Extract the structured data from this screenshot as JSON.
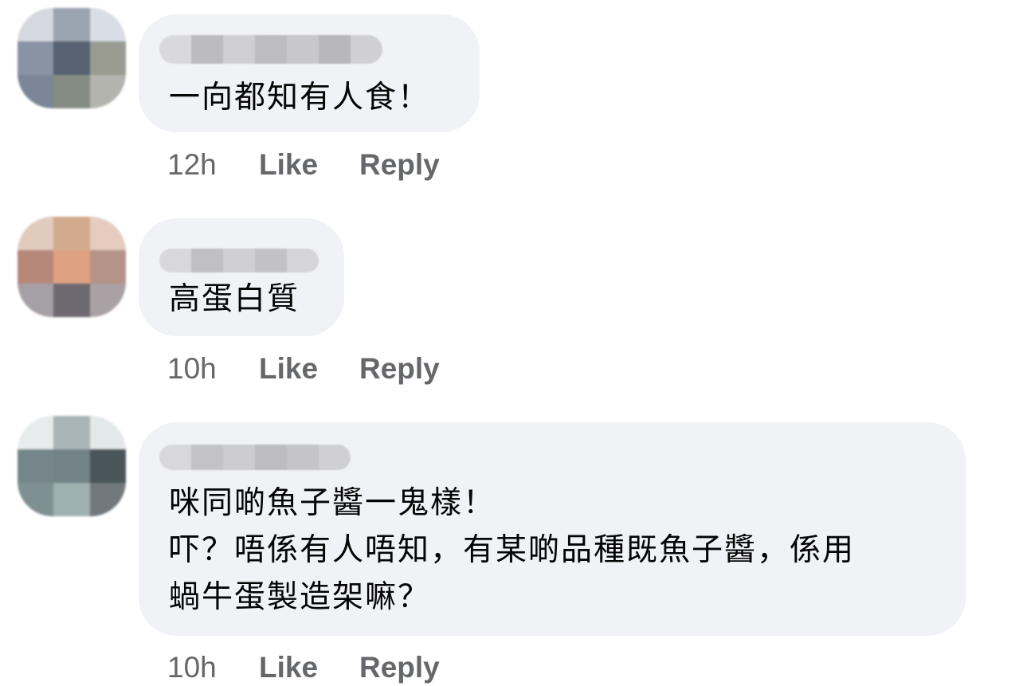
{
  "comments": [
    {
      "text": "一向都知有人食！",
      "time": "12h",
      "like_label": "Like",
      "reply_label": "Reply"
    },
    {
      "text": "高蛋白質",
      "time": "10h",
      "like_label": "Like",
      "reply_label": "Reply"
    },
    {
      "text": "咪同啲魚子醬一鬼樣！\n吓？唔係有人唔知，有某啲品種既魚子醬，係用\n蝸牛蛋製造架嘛？",
      "time": "10h",
      "like_label": "Like",
      "reply_label": "Reply"
    }
  ],
  "colors": {
    "bubble": "#f0f2f5",
    "text": "#050505",
    "meta": "#65676b"
  }
}
